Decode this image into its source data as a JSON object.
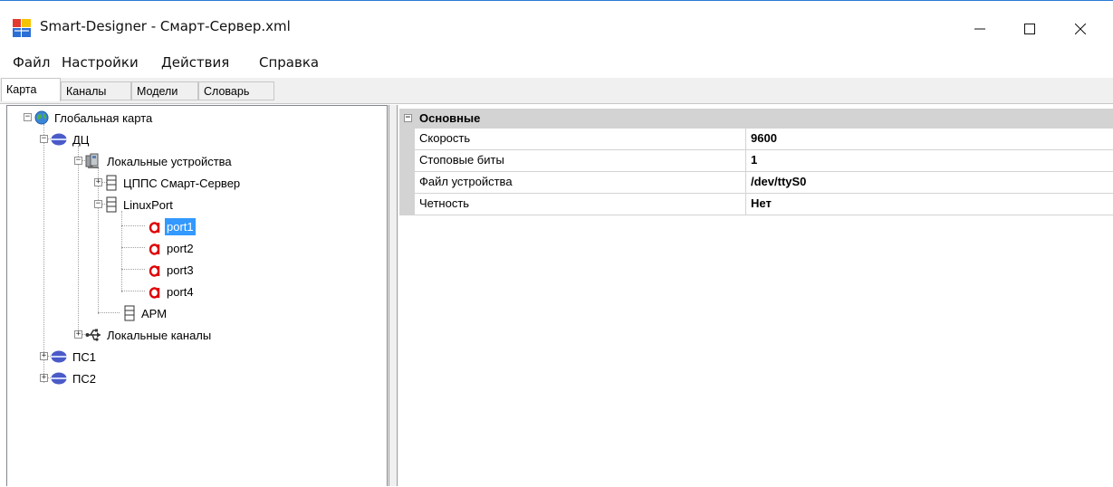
{
  "window": {
    "title": "Smart-Designer - Смарт-Сервер.xml",
    "controls": [
      "minimize",
      "maximize",
      "close"
    ]
  },
  "menu": [
    "Файл",
    "Настройки",
    "Действия",
    "Справка"
  ],
  "tabs": [
    {
      "label": "Карта",
      "active": true
    },
    {
      "label": "Каналы",
      "active": false
    },
    {
      "label": "Модели",
      "active": false
    },
    {
      "label": "Словарь",
      "active": false
    }
  ],
  "tree": {
    "root": {
      "label": "Глобальная карта",
      "icon": "globe-icon",
      "expanded": true
    },
    "dc": {
      "label": "ДЦ",
      "icon": "server-icon",
      "expanded": true
    },
    "local_devices": {
      "label": "Локальные устройства",
      "icon": "computers-icon",
      "expanded": true
    },
    "smart_server": {
      "label": "ЦППС Смарт-Сервер",
      "icon": "device-icon",
      "expanded": false
    },
    "linux_port": {
      "label": "LinuxPort",
      "icon": "device-icon",
      "expanded": true
    },
    "ports": [
      {
        "label": "port1",
        "icon": "port-icon",
        "selected": true
      },
      {
        "label": "port2",
        "icon": "port-icon",
        "selected": false
      },
      {
        "label": "port3",
        "icon": "port-icon",
        "selected": false
      },
      {
        "label": "port4",
        "icon": "port-icon",
        "selected": false
      }
    ],
    "arm": {
      "label": "АРМ",
      "icon": "device-icon"
    },
    "local_channels": {
      "label": "Локальные каналы",
      "icon": "usb-icon",
      "expanded": false
    },
    "ps1": {
      "label": "ПС1",
      "icon": "server-icon",
      "expanded": false
    },
    "ps2": {
      "label": "ПС2",
      "icon": "server-icon",
      "expanded": false
    }
  },
  "properties": {
    "category": "Основные",
    "rows": [
      {
        "name": "Скорость",
        "value": "9600"
      },
      {
        "name": "Стоповые биты",
        "value": "1"
      },
      {
        "name": "Файл устройства",
        "value": "/dev/ttyS0"
      },
      {
        "name": "Четность",
        "value": "Нет"
      }
    ]
  },
  "colors": {
    "selection": "#3399ff",
    "port_icon": "#e00000",
    "accent_line": "#2b79d6",
    "grid_gray": "#d3d3d3"
  }
}
